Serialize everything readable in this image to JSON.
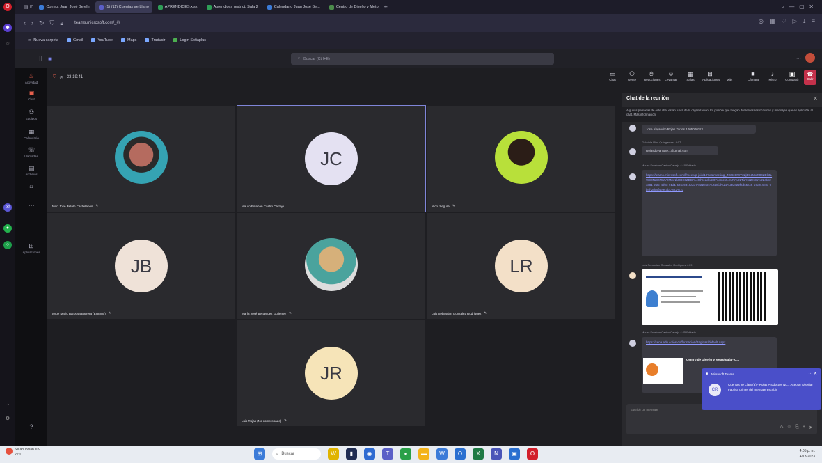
{
  "browser": {
    "tabs": [
      {
        "label": "Correo: Juan José Betelh",
        "active": false,
        "color": "#3b7bd8"
      },
      {
        "label": "(1) (11) Cuentas ae Llano",
        "active": true,
        "color": "#5b5fc7"
      },
      {
        "label": "APRENDICES.xlsx",
        "active": false,
        "color": "#2f9e57"
      },
      {
        "label": "Aprendices restrict. Sala 2",
        "active": false,
        "color": "#2f9e57"
      },
      {
        "label": "Calendario Juan José Be...",
        "active": false,
        "color": "#3b7bd8"
      },
      {
        "label": "Centro de Diseño y Meto",
        "active": false,
        "color": "#4b8c4b"
      }
    ],
    "url": "teams.microsoft.com/_#/",
    "bookmarks": [
      "Nueva carpeta",
      "Gmail",
      "YouTube",
      "Maps",
      "Traducir",
      "Login Sofiaplus"
    ]
  },
  "teams": {
    "search_placeholder": "Buscar (Ctrl+E)",
    "rail": [
      "Actividad",
      "Chat",
      "Equipos",
      "Calendario",
      "Llamadas",
      "Archivos",
      "Aplicaciones",
      "Ayuda"
    ],
    "timer": "33:19:41",
    "controls": [
      "Chat",
      "Gente",
      "Reacciones",
      "Levantar",
      "Salas",
      "Aplicaciones",
      "Más",
      "Cámara",
      "Micro",
      "Compartir",
      "Salir"
    ]
  },
  "participants": [
    {
      "name": "Juan José Betelh Castellanos",
      "initials": "",
      "photo": "photo1"
    },
    {
      "name": "Mauro Esteban Castro Carrejo",
      "initials": "JC",
      "photo": ""
    },
    {
      "name": "Nicol Segura",
      "initials": "",
      "photo": "photo2"
    },
    {
      "name": "Jorge Mario Barbosa Barrera (Externo)",
      "initials": "JB",
      "photo": ""
    },
    {
      "name": "María José Benavidez Gutierrez",
      "initials": "",
      "photo": "photo3"
    },
    {
      "name": "Luis Sebastian Gonzalez Rodriguez",
      "initials": "LR",
      "photo": ""
    },
    {
      "name": "Luis Rojas (No comprobado)",
      "initials": "JR",
      "photo": ""
    }
  ],
  "chat": {
    "title": "Chat de la reunión",
    "banner": "Algunas personas de este chat están fuera de la organización. Es posible que tengan diferentes restricciones y mensajes que es aplicable al chat. Más información",
    "messages": [
      {
        "meta": "",
        "text": "Jose Alejandro Rojas Torres 1005000113"
      },
      {
        "meta": "Gabriela Rios Quingamara 4:07",
        "text": "Rojasduvanjose.1@gmail.com"
      },
      {
        "meta": "Mauro Esteban Castro Carrejo 4:10 Editado",
        "text": "https://teams.microsoft.com/l/meetup-join/19%3ameeting_ZGUxOWY2ZjEtNjMxZi00ZDk3LWE0NzEtNWY2MmNhODE0ZDBl%40thread.v2/0?context=%7b%22Tid%22%3a%22cbc2c381-2f2e-4d93-91d1-506c9316ace7%22%2c%22Oid%22%3a%22f6d65bc5-a7e0-4e8c-9b4f-2dc9f4e9c7b1%22%7d"
      },
      {
        "meta": "Luis Sebastian Gonzalez Rodriguez 4:09",
        "text": ""
      },
      {
        "meta": "Mauro Esteban Castro Carrejo 4:45 Editado",
        "text": "https://sena.edu.co/es-co/formacion/Paginas/default.aspx"
      },
      {
        "meta": "",
        "text": "Centro de Diseño y Metrología - C..."
      }
    ],
    "compose_placeholder": "Escribir un mensaje"
  },
  "toast": {
    "app": "Microsoft Teams",
    "text": "Cuentas ae Llano(a) - Rojas Productos No... Aceptar Diseñar | Fabrica primer del mensaje escribir"
  },
  "taskbar": {
    "weather": "Se anuncian lluv...",
    "temp": "22°C",
    "search": "Buscar",
    "time": "4:05 p. m.",
    "date": "4/13/2023"
  }
}
